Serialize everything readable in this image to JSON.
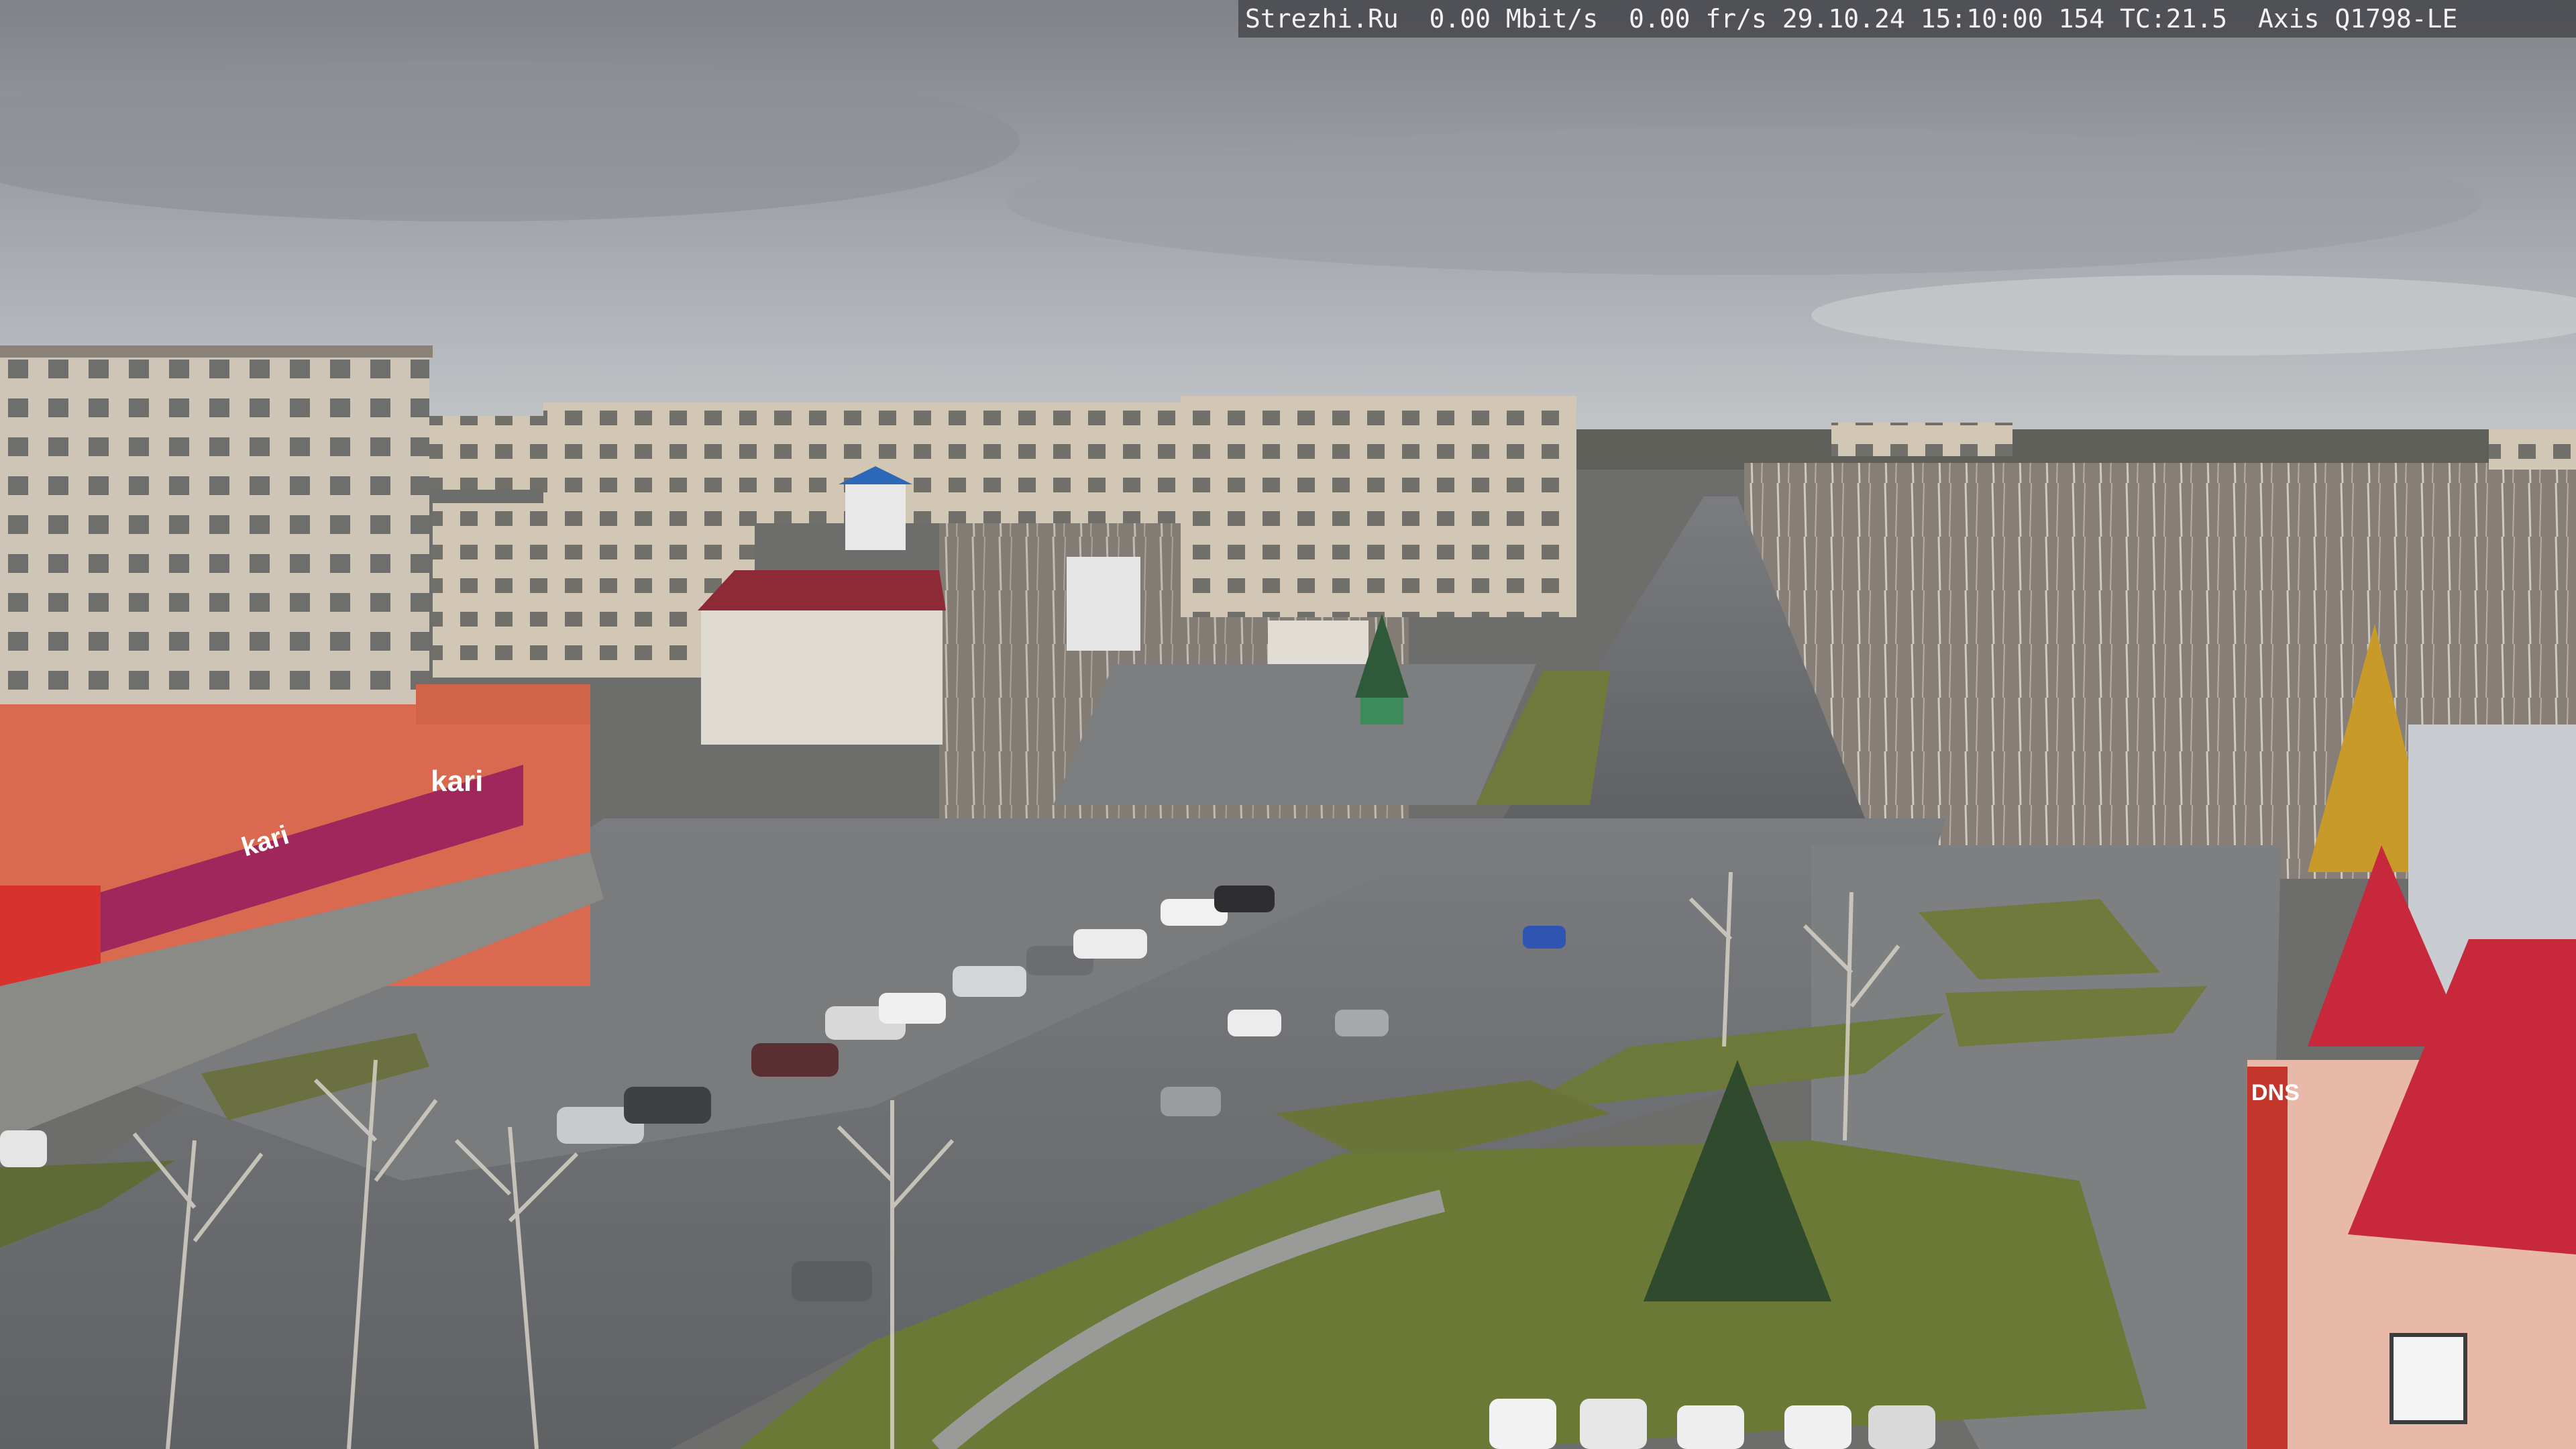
{
  "overlay": {
    "text": "Strezhi.Ru  0.00 Mbit/s  0.00 fr/s 29.10.24 15:10:00 154 TC:21.5  Axis Q1798-LE"
  },
  "signs": {
    "shop_brand": "kari",
    "shop_brand_small": "kari",
    "store_right": "DNS"
  },
  "colors": {
    "sky": "#a3a7ac",
    "road": "#6e7073",
    "grass": "#6f7a3c",
    "shop_facade": "#d9694f",
    "banner": "#a0275c",
    "roof_red": "#c8283c"
  }
}
